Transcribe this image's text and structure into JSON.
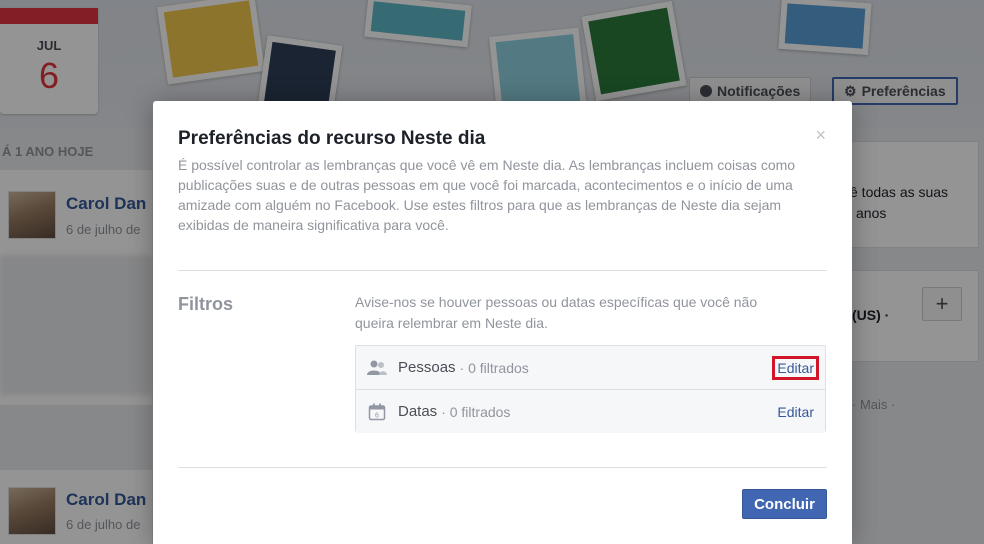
{
  "calendar": {
    "month": "JUL",
    "day": "6"
  },
  "header": {
    "notifications_label": "Notificações",
    "preferences_label": "Preferências"
  },
  "feed": {
    "section_label": "Á 1 ANO HOJE",
    "posts": [
      {
        "name": "Carol Dan",
        "date": "6 de julho de"
      },
      {
        "name": "Carol Dan",
        "date": "6 de julho de"
      }
    ]
  },
  "right_column": {
    "text_line1": "ê todas as suas",
    "text_line2": "anos",
    "text_line3": "(US) ·",
    "more_label": "· Mais ·"
  },
  "dialog": {
    "title": "Preferências do recurso Neste dia",
    "description": "É possível controlar as lembranças que você vê em Neste dia. As lembranças incluem coisas como publicações suas e de outras pessoas em que você foi marcada, acontecimentos e o início de uma amizade com alguém no Facebook. Use estes filtros para que as lembranças de Neste dia sejam exibidas de maneira significativa para você.",
    "close_glyph": "×",
    "filters_label": "Filtros",
    "filters_help": "Avise-nos se houver pessoas ou datas específicas que você não queira relembrar em Neste dia.",
    "filters": [
      {
        "label": "Pessoas",
        "count": "· 0 filtrados",
        "edit": "Editar",
        "icon": "people-icon"
      },
      {
        "label": "Datas",
        "count": "· 0 filtrados",
        "edit": "Editar",
        "icon": "calendar-icon"
      }
    ],
    "done_label": "Concluir"
  },
  "colors": {
    "accent": "#4267b2",
    "highlight": "#d2162a",
    "calendar_red": "#e0343f"
  }
}
